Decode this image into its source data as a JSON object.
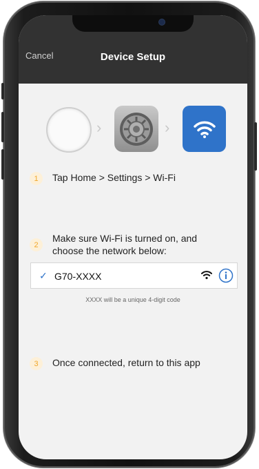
{
  "header": {
    "cancel_label": "Cancel",
    "title": "Device Setup"
  },
  "step_icons": [
    "home-button-icon",
    "settings-app-icon",
    "wifi-icon"
  ],
  "steps": [
    {
      "number": "1",
      "text": "Tap Home > Settings > Wi-Fi"
    },
    {
      "number": "2",
      "text_line1": "Make sure Wi-Fi is turned on, and",
      "text_line2": "choose the network below:"
    },
    {
      "number": "3",
      "text": "Once connected, return to this app"
    }
  ],
  "network": {
    "name": "G70-XXXX",
    "selected": true,
    "hint": "XXXX will be a unique 4-digit code"
  },
  "colors": {
    "header_bg": "#323232",
    "accent_blue": "#2f73c9",
    "badge_text": "#f0a72b",
    "badge_bg": "#fdf0d8"
  }
}
